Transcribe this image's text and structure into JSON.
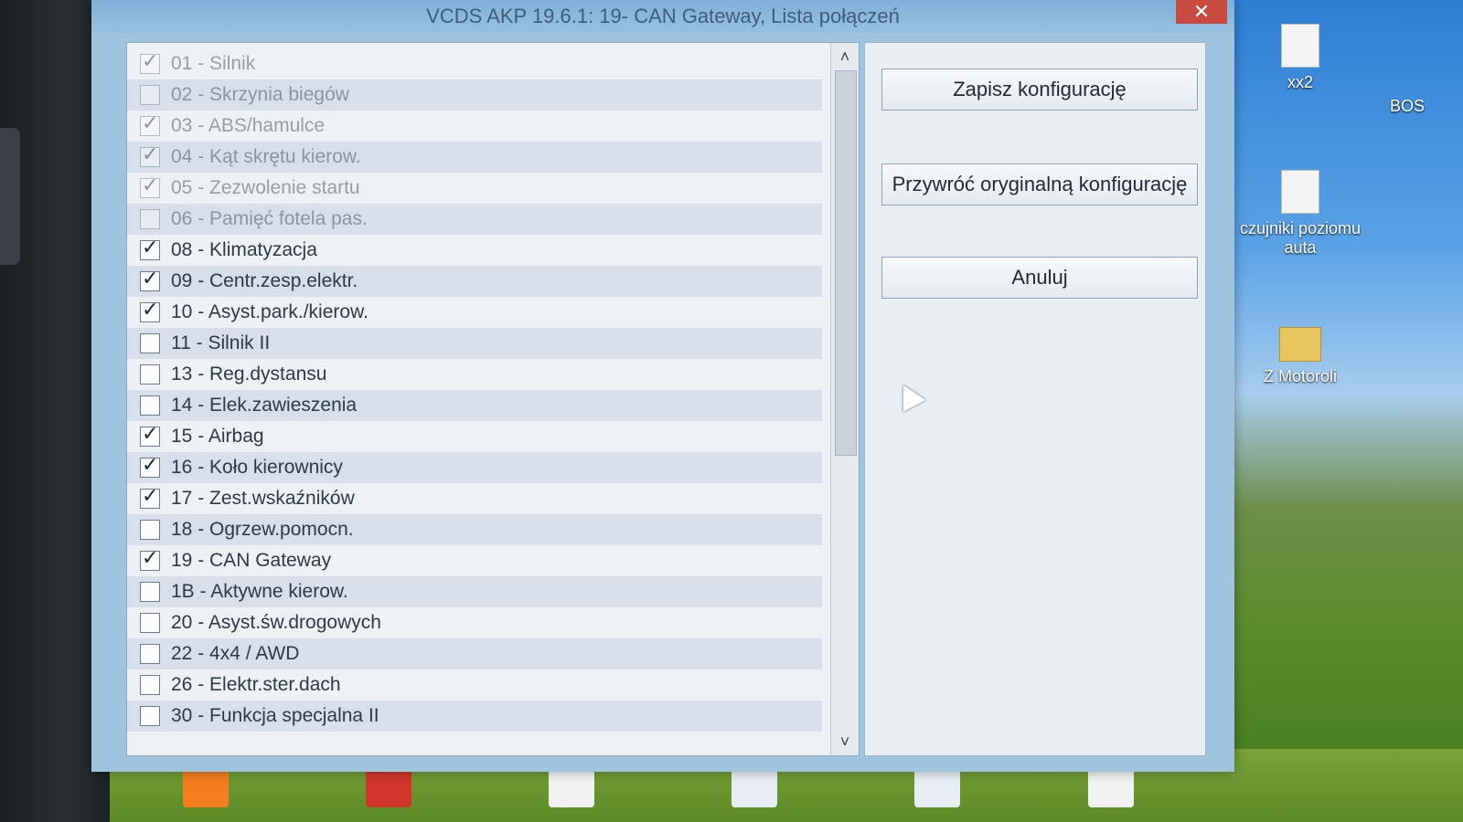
{
  "window": {
    "title": "VCDS AKP 19.6.1: 19- CAN Gateway,  Lista połączeń",
    "close_glyph": "✕"
  },
  "list": {
    "items": [
      {
        "label": "01 - Silnik",
        "checked": true
      },
      {
        "label": "02 - Skrzynia biegów",
        "checked": false
      },
      {
        "label": "03 - ABS/hamulce",
        "checked": true
      },
      {
        "label": "04 - Kąt skrętu kierow.",
        "checked": true
      },
      {
        "label": "05 - Zezwolenie startu",
        "checked": true
      },
      {
        "label": "06 - Pamięć fotela pas.",
        "checked": false
      },
      {
        "label": "08 - Klimatyzacja",
        "checked": true
      },
      {
        "label": "09 - Centr.zesp.elektr.",
        "checked": true
      },
      {
        "label": "10 - Asyst.park./kierow.",
        "checked": true
      },
      {
        "label": "11 - Silnik II",
        "checked": false
      },
      {
        "label": "13 - Reg.dystansu",
        "checked": false
      },
      {
        "label": "14 - Elek.zawieszenia",
        "checked": false
      },
      {
        "label": "15 - Airbag",
        "checked": true
      },
      {
        "label": "16 - Koło kierownicy",
        "checked": true
      },
      {
        "label": "17 - Zest.wskaźników",
        "checked": true
      },
      {
        "label": "18 - Ogrzew.pomocn.",
        "checked": false
      },
      {
        "label": "19 - CAN Gateway",
        "checked": true
      },
      {
        "label": "1B - Aktywne kierow.",
        "checked": false
      },
      {
        "label": "20 - Asyst.św.drogowych",
        "checked": false
      },
      {
        "label": "22 - 4x4 / AWD",
        "checked": false
      },
      {
        "label": "26 - Elektr.ster.dach",
        "checked": false
      },
      {
        "label": "30 - Funkcja specjalna II",
        "checked": false
      }
    ],
    "scroll_up_glyph": "˄",
    "scroll_down_glyph": "˅"
  },
  "buttons": {
    "save": "Zapisz konfigurację",
    "restore": "Przywróć oryginalną konfigurację",
    "cancel": "Anuluj"
  },
  "desktop": {
    "icons": [
      {
        "label": "xx2"
      },
      {
        "label": "czujniki poziomu auta"
      },
      {
        "label": "Z Motoroli"
      }
    ],
    "partial_label": "BOS"
  },
  "taskbar": {
    "icons": [
      {
        "name": "firefox-shortcut",
        "color": "#f57c1f"
      },
      {
        "name": "autodata-shortcut",
        "color": "#d2352b"
      },
      {
        "name": "document-file",
        "color": "#f2f2f2"
      },
      {
        "name": "word-document",
        "color": "#e9eef6"
      },
      {
        "name": "word-document-2",
        "color": "#e9eef6"
      },
      {
        "name": "document-file-2",
        "color": "#f2f2f2"
      }
    ]
  }
}
